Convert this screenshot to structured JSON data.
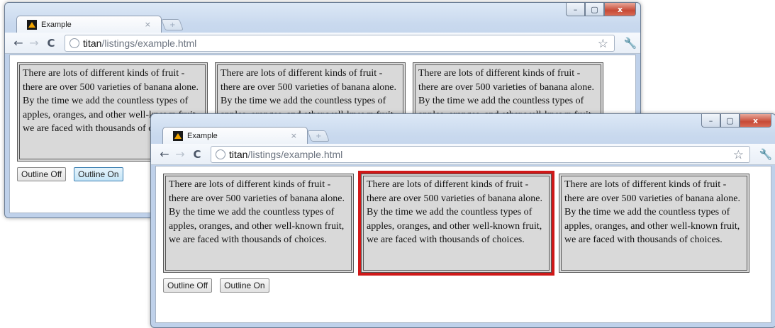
{
  "tab": {
    "title": "Example",
    "close": "×",
    "newtab": "+"
  },
  "window_controls": {
    "minimize": "–",
    "maximize": "▢",
    "close": "x"
  },
  "nav": {
    "back": "←",
    "forward": "→",
    "reload": "C",
    "star": "☆",
    "wrench": "🔧"
  },
  "omnibox": {
    "host": "titan",
    "path": "/listings/example.html"
  },
  "fruit_text": "There are lots of different kinds of fruit - there are over 500 varieties of banana alone. By the time we add the countless types of apples, oranges, and other well-known fruit, we are faced with thousands of choices.",
  "buttons": {
    "outline_off": "Outline Off",
    "outline_on": "Outline On"
  },
  "colors": {
    "outline": "#d01818",
    "panel_bg": "#d9d9d9",
    "hover_button": "#c5e5f7"
  }
}
